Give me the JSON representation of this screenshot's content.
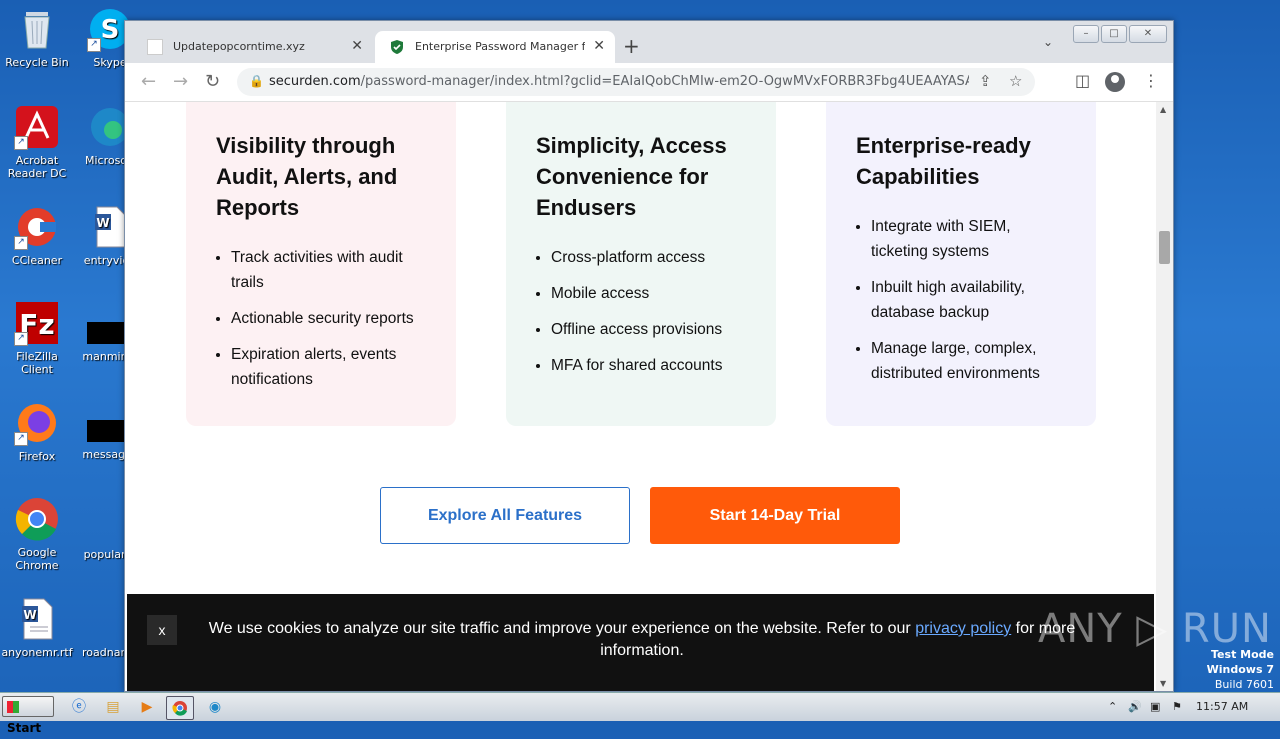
{
  "desktop": {
    "icons": [
      {
        "label": "Recycle Bin"
      },
      {
        "label": "Skype"
      },
      {
        "label": "Acrobat Reader DC"
      },
      {
        "label": "Microsoft"
      },
      {
        "label": "CCleaner"
      },
      {
        "label": "entryvide"
      },
      {
        "label": "FileZilla Client"
      },
      {
        "label": "manminin"
      },
      {
        "label": "Firefox"
      },
      {
        "label": "messages"
      },
      {
        "label": "Google Chrome"
      },
      {
        "label": "popularre"
      },
      {
        "label": "anyonemr.rtf"
      },
      {
        "label": "roadname"
      }
    ]
  },
  "browser": {
    "tabs": [
      {
        "title": "Updatepopcorntime.xyz",
        "active": false
      },
      {
        "title": "Enterprise Password Manager for Te",
        "active": true
      }
    ],
    "new_tab_symbol": "+",
    "tab_close_symbol": "✕",
    "url_domain": "securden.com",
    "url_path": "/password-manager/index.html?gclid=EAIaIQobChMIw-em2O-OgwMVxFORBR3Fbg4UEAAYASAAEgITX...",
    "nav_back": "←",
    "nav_forward": "→",
    "nav_reload": "↻"
  },
  "page": {
    "cards": [
      {
        "title": "Visibility through Audit, Alerts, and Reports",
        "items": [
          "Track activities with audit trails",
          "Actionable security reports",
          "Expiration alerts, events notifications"
        ]
      },
      {
        "title": "Simplicity, Access Convenience for Endusers",
        "items": [
          "Cross-platform access",
          "Mobile access",
          "Offline access provisions",
          "MFA for shared accounts"
        ]
      },
      {
        "title": "Enterprise-ready Capabilities",
        "items": [
          "Integrate with SIEM, ticketing systems",
          "Inbuilt high availability, database backup",
          "Manage large, complex, distributed environments"
        ]
      }
    ],
    "explore_button": "Explore All Features",
    "trial_button": "Start 14-Day Trial",
    "cookie": {
      "close": "x",
      "text_before": "We use cookies to analyze our site traffic and improve your experience on the website. Refer to our ",
      "link": "privacy policy",
      "text_after": " for more information."
    }
  },
  "watermark": {
    "brand": "ANY ▷ RUN",
    "line1": "Test Mode",
    "line2": "Windows 7",
    "line3": "Build 7601"
  },
  "taskbar": {
    "start_label": "Start",
    "clock": "11:57 AM"
  },
  "colors": {
    "trial_orange": "#ff5a0a",
    "explore_blue": "#2b70c9",
    "card1_bg": "#fdf1f3",
    "card2_bg": "#eff7f4",
    "card3_bg": "#f3f2fd"
  }
}
